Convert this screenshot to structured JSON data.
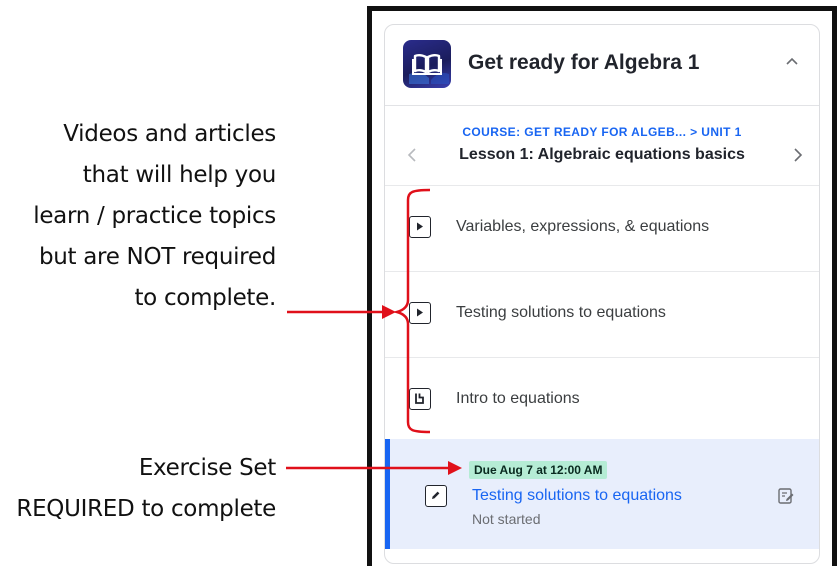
{
  "annotations": {
    "videos_lines": [
      "Videos and articles",
      "that will help you",
      "learn / practice topics",
      "but are NOT required",
      "to complete."
    ],
    "exercise_lines": [
      "Exercise Set",
      "REQUIRED to complete"
    ],
    "arrow_color": "#e0101a"
  },
  "course": {
    "title": "Get ready for Algebra 1",
    "icon": "open-book-icon"
  },
  "lesson_nav": {
    "breadcrumb_course": "COURSE: GET READY FOR ALGEB...",
    "breadcrumb_sep": ">",
    "breadcrumb_unit": "UNIT 1",
    "lesson_title": "Lesson 1: Algebraic equations basics"
  },
  "items": [
    {
      "type": "video",
      "icon": "play-icon",
      "label": "Variables, expressions, & equations"
    },
    {
      "type": "video",
      "icon": "play-icon",
      "label": "Testing solutions to equations"
    },
    {
      "type": "article",
      "icon": "article-icon",
      "label": "Intro to equations"
    }
  ],
  "exercise": {
    "due": "Due Aug 7 at 12:00 AM",
    "title": "Testing solutions to equations",
    "status": "Not started",
    "icon": "pencil-icon",
    "accent": "#1865f2",
    "badge_color": "#b5ecd5",
    "highlight_bg": "#e8eefc"
  }
}
